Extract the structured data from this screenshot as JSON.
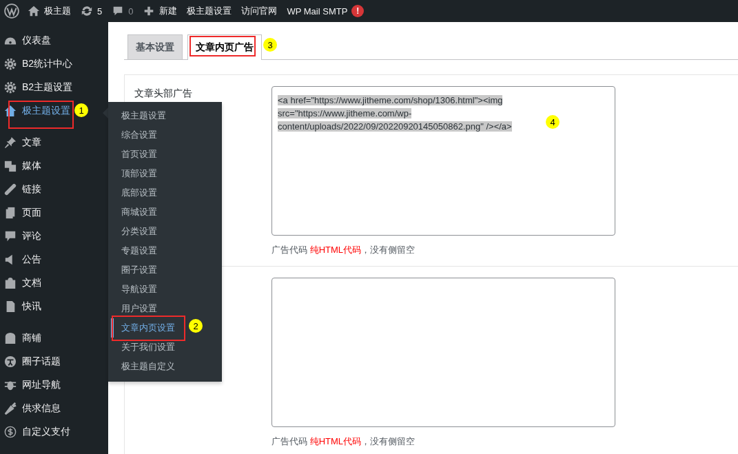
{
  "admin_bar": {
    "site": "极主题",
    "updates": "5",
    "comments": "0",
    "new": "新建",
    "links": [
      "极主题设置",
      "访问官网"
    ],
    "smtp": "WP Mail SMTP",
    "smtp_alert": "!"
  },
  "sidebar": {
    "groups": [
      {
        "items": [
          {
            "label": "仪表盘",
            "selected": false
          },
          {
            "label": "B2统计中心",
            "selected": false
          },
          {
            "label": "B2主题设置",
            "selected": false
          },
          {
            "label": "极主题设置",
            "selected": true,
            "annotation": "1"
          }
        ]
      },
      {
        "items": [
          {
            "label": "文章",
            "selected": false
          },
          {
            "label": "媒体",
            "selected": false
          },
          {
            "label": "链接",
            "selected": false
          },
          {
            "label": "页面",
            "selected": false
          },
          {
            "label": "评论",
            "selected": false
          },
          {
            "label": "公告",
            "selected": false
          },
          {
            "label": "文档",
            "selected": false
          },
          {
            "label": "快讯",
            "selected": false
          }
        ]
      },
      {
        "items": [
          {
            "label": "商铺",
            "selected": false
          },
          {
            "label": "圈子话题",
            "selected": false
          },
          {
            "label": "网址导航",
            "selected": false
          },
          {
            "label": "供求信息",
            "selected": false
          },
          {
            "label": "自定义支付",
            "selected": false
          }
        ]
      }
    ]
  },
  "submenu": {
    "items": [
      {
        "label": "极主题设置",
        "selected": false
      },
      {
        "label": "综合设置",
        "selected": false
      },
      {
        "label": "首页设置",
        "selected": false
      },
      {
        "label": "顶部设置",
        "selected": false
      },
      {
        "label": "底部设置",
        "selected": false
      },
      {
        "label": "商城设置",
        "selected": false
      },
      {
        "label": "分类设置",
        "selected": false
      },
      {
        "label": "专题设置",
        "selected": false
      },
      {
        "label": "圈子设置",
        "selected": false
      },
      {
        "label": "导航设置",
        "selected": false
      },
      {
        "label": "用户设置",
        "selected": false
      },
      {
        "label": "文章内页设置",
        "selected": true,
        "annotation": "2"
      },
      {
        "label": "关于我们设置",
        "selected": false
      },
      {
        "label": "极主题自定义",
        "selected": false
      }
    ]
  },
  "tabs": [
    {
      "label": "基本设置",
      "selected": false
    },
    {
      "label": "文章内页广告",
      "selected": true,
      "annotation": "3"
    }
  ],
  "fields": [
    {
      "label": "文章头部广告",
      "value_lines": [
        "<a href=\"https://www.jitheme.com/shop/1306.html\"><img",
        "src=\"https://www.jitheme.com/wp-",
        "content/uploads/2022/09/20220920145050862.png\" /></a>"
      ],
      "annotation": "4",
      "help": {
        "prefix": "广告代码 ",
        "highlight": "纯HTML代码",
        "suffix": "，没有侧留空"
      }
    },
    {
      "help": {
        "prefix": "广告代码 ",
        "highlight": "纯HTML代码",
        "suffix": "，没有侧留空"
      }
    }
  ]
}
